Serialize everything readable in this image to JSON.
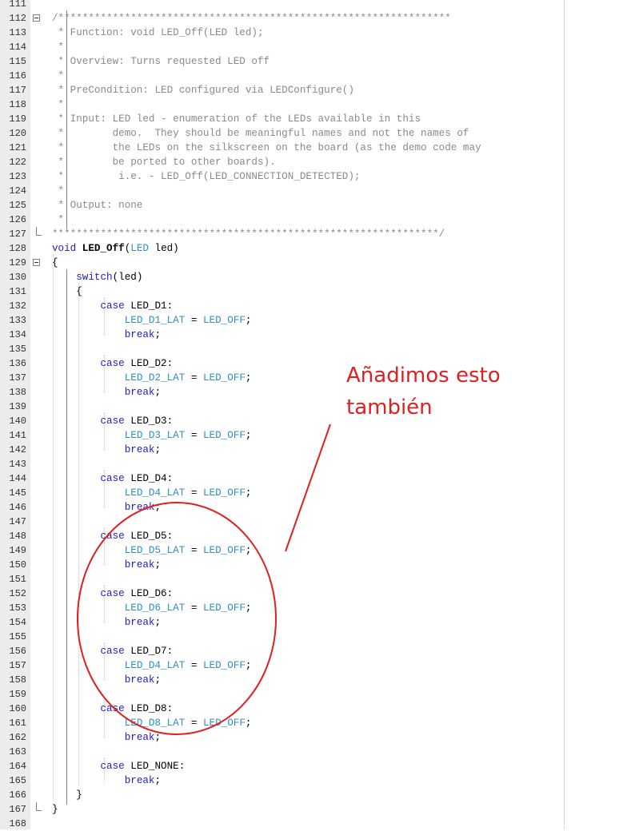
{
  "lines": [
    {
      "n": "111",
      "tokens": []
    },
    {
      "n": "112",
      "tokens": [
        {
          "t": "/*****************************************************************",
          "c": "comment"
        }
      ]
    },
    {
      "n": "113",
      "tokens": [
        {
          "t": " * Function: void LED_Off(LED led);",
          "c": "comment"
        }
      ]
    },
    {
      "n": "114",
      "tokens": [
        {
          "t": " *",
          "c": "comment"
        }
      ]
    },
    {
      "n": "115",
      "tokens": [
        {
          "t": " * Overview: Turns requested LED off",
          "c": "comment"
        }
      ]
    },
    {
      "n": "116",
      "tokens": [
        {
          "t": " *",
          "c": "comment"
        }
      ]
    },
    {
      "n": "117",
      "tokens": [
        {
          "t": " * PreCondition: LED configured via LEDConfigure()",
          "c": "comment"
        }
      ]
    },
    {
      "n": "118",
      "tokens": [
        {
          "t": " *",
          "c": "comment"
        }
      ]
    },
    {
      "n": "119",
      "tokens": [
        {
          "t": " * Input: LED led - enumeration of the LEDs available in this",
          "c": "comment"
        }
      ]
    },
    {
      "n": "120",
      "tokens": [
        {
          "t": " *        demo.  They should be meaningful names and not the names of",
          "c": "comment"
        }
      ]
    },
    {
      "n": "121",
      "tokens": [
        {
          "t": " *        the LEDs on the silkscreen on the board (as the demo code may",
          "c": "comment"
        }
      ]
    },
    {
      "n": "122",
      "tokens": [
        {
          "t": " *        be ported to other boards).",
          "c": "comment"
        }
      ]
    },
    {
      "n": "123",
      "tokens": [
        {
          "t": " *         i.e. - LED_Off(LED_CONNECTION_DETECTED);",
          "c": "comment"
        }
      ]
    },
    {
      "n": "124",
      "tokens": [
        {
          "t": " *",
          "c": "comment"
        }
      ]
    },
    {
      "n": "125",
      "tokens": [
        {
          "t": " * Output: none",
          "c": "comment"
        }
      ]
    },
    {
      "n": "126",
      "tokens": [
        {
          "t": " *",
          "c": "comment"
        }
      ]
    },
    {
      "n": "127",
      "tokens": [
        {
          "t": "****************************************************************/",
          "c": "comment"
        }
      ]
    },
    {
      "n": "128",
      "tokens": [
        {
          "t": "void ",
          "c": "kw"
        },
        {
          "t": "LED_Off",
          "c": "fn"
        },
        {
          "t": "(",
          "c": "plain"
        },
        {
          "t": "LED",
          "c": "ident"
        },
        {
          "t": " led)",
          "c": "plain"
        }
      ]
    },
    {
      "n": "129",
      "tokens": [
        {
          "t": "{",
          "c": "plain"
        }
      ]
    },
    {
      "n": "130",
      "tokens": [
        {
          "t": "    ",
          "c": "plain"
        },
        {
          "t": "switch",
          "c": "kw"
        },
        {
          "t": "(led)",
          "c": "plain"
        }
      ]
    },
    {
      "n": "131",
      "tokens": [
        {
          "t": "    {",
          "c": "plain"
        }
      ]
    },
    {
      "n": "132",
      "tokens": [
        {
          "t": "        ",
          "c": "plain"
        },
        {
          "t": "case",
          "c": "kw"
        },
        {
          "t": " LED_D1:",
          "c": "plain"
        }
      ]
    },
    {
      "n": "133",
      "tokens": [
        {
          "t": "            ",
          "c": "plain"
        },
        {
          "t": "LED_D1_LAT",
          "c": "ident"
        },
        {
          "t": " = ",
          "c": "plain"
        },
        {
          "t": "LED_OFF",
          "c": "ident"
        },
        {
          "t": ";",
          "c": "plain"
        }
      ]
    },
    {
      "n": "134",
      "tokens": [
        {
          "t": "            ",
          "c": "plain"
        },
        {
          "t": "break",
          "c": "kw"
        },
        {
          "t": ";",
          "c": "plain"
        }
      ]
    },
    {
      "n": "135",
      "tokens": []
    },
    {
      "n": "136",
      "tokens": [
        {
          "t": "        ",
          "c": "plain"
        },
        {
          "t": "case",
          "c": "kw"
        },
        {
          "t": " LED_D2:",
          "c": "plain"
        }
      ]
    },
    {
      "n": "137",
      "tokens": [
        {
          "t": "            ",
          "c": "plain"
        },
        {
          "t": "LED_D2_LAT",
          "c": "ident"
        },
        {
          "t": " = ",
          "c": "plain"
        },
        {
          "t": "LED_OFF",
          "c": "ident"
        },
        {
          "t": ";",
          "c": "plain"
        }
      ]
    },
    {
      "n": "138",
      "tokens": [
        {
          "t": "            ",
          "c": "plain"
        },
        {
          "t": "break",
          "c": "kw"
        },
        {
          "t": ";",
          "c": "plain"
        }
      ]
    },
    {
      "n": "139",
      "tokens": []
    },
    {
      "n": "140",
      "tokens": [
        {
          "t": "        ",
          "c": "plain"
        },
        {
          "t": "case",
          "c": "kw"
        },
        {
          "t": " LED_D3:",
          "c": "plain"
        }
      ]
    },
    {
      "n": "141",
      "tokens": [
        {
          "t": "            ",
          "c": "plain"
        },
        {
          "t": "LED_D3_LAT",
          "c": "ident"
        },
        {
          "t": " = ",
          "c": "plain"
        },
        {
          "t": "LED_OFF",
          "c": "ident"
        },
        {
          "t": ";",
          "c": "plain"
        }
      ]
    },
    {
      "n": "142",
      "tokens": [
        {
          "t": "            ",
          "c": "plain"
        },
        {
          "t": "break",
          "c": "kw"
        },
        {
          "t": ";",
          "c": "plain"
        }
      ]
    },
    {
      "n": "143",
      "tokens": []
    },
    {
      "n": "144",
      "tokens": [
        {
          "t": "        ",
          "c": "plain"
        },
        {
          "t": "case",
          "c": "kw"
        },
        {
          "t": " LED_D4:",
          "c": "plain"
        }
      ]
    },
    {
      "n": "145",
      "tokens": [
        {
          "t": "            ",
          "c": "plain"
        },
        {
          "t": "LED_D4_LAT",
          "c": "ident"
        },
        {
          "t": " = ",
          "c": "plain"
        },
        {
          "t": "LED_OFF",
          "c": "ident"
        },
        {
          "t": ";",
          "c": "plain"
        }
      ]
    },
    {
      "n": "146",
      "tokens": [
        {
          "t": "            ",
          "c": "plain"
        },
        {
          "t": "break",
          "c": "kw"
        },
        {
          "t": ";",
          "c": "plain"
        }
      ]
    },
    {
      "n": "147",
      "tokens": []
    },
    {
      "n": "148",
      "tokens": [
        {
          "t": "        ",
          "c": "plain"
        },
        {
          "t": "case",
          "c": "kw"
        },
        {
          "t": " LED_D5:",
          "c": "plain"
        }
      ]
    },
    {
      "n": "149",
      "tokens": [
        {
          "t": "            ",
          "c": "plain"
        },
        {
          "t": "LED_D5_LAT",
          "c": "ident"
        },
        {
          "t": " = ",
          "c": "plain"
        },
        {
          "t": "LED_OFF",
          "c": "ident"
        },
        {
          "t": ";",
          "c": "plain"
        }
      ]
    },
    {
      "n": "150",
      "tokens": [
        {
          "t": "            ",
          "c": "plain"
        },
        {
          "t": "break",
          "c": "kw"
        },
        {
          "t": ";",
          "c": "plain"
        }
      ]
    },
    {
      "n": "151",
      "tokens": []
    },
    {
      "n": "152",
      "tokens": [
        {
          "t": "        ",
          "c": "plain"
        },
        {
          "t": "case",
          "c": "kw"
        },
        {
          "t": " LED_D6:",
          "c": "plain"
        }
      ]
    },
    {
      "n": "153",
      "tokens": [
        {
          "t": "            ",
          "c": "plain"
        },
        {
          "t": "LED_D6_LAT",
          "c": "ident"
        },
        {
          "t": " = ",
          "c": "plain"
        },
        {
          "t": "LED_OFF",
          "c": "ident"
        },
        {
          "t": ";",
          "c": "plain"
        }
      ]
    },
    {
      "n": "154",
      "tokens": [
        {
          "t": "            ",
          "c": "plain"
        },
        {
          "t": "break",
          "c": "kw"
        },
        {
          "t": ";",
          "c": "plain"
        }
      ]
    },
    {
      "n": "155",
      "tokens": []
    },
    {
      "n": "156",
      "tokens": [
        {
          "t": "        ",
          "c": "plain"
        },
        {
          "t": "case",
          "c": "kw"
        },
        {
          "t": " LED_D7:",
          "c": "plain"
        }
      ]
    },
    {
      "n": "157",
      "tokens": [
        {
          "t": "            ",
          "c": "plain"
        },
        {
          "t": "LED_D4_LAT",
          "c": "ident"
        },
        {
          "t": " = ",
          "c": "plain"
        },
        {
          "t": "LED_OFF",
          "c": "ident"
        },
        {
          "t": ";",
          "c": "plain"
        }
      ]
    },
    {
      "n": "158",
      "tokens": [
        {
          "t": "            ",
          "c": "plain"
        },
        {
          "t": "break",
          "c": "kw"
        },
        {
          "t": ";",
          "c": "plain"
        }
      ]
    },
    {
      "n": "159",
      "tokens": []
    },
    {
      "n": "160",
      "tokens": [
        {
          "t": "        ",
          "c": "plain"
        },
        {
          "t": "case",
          "c": "kw"
        },
        {
          "t": " LED_D8:",
          "c": "plain"
        }
      ]
    },
    {
      "n": "161",
      "tokens": [
        {
          "t": "            ",
          "c": "plain"
        },
        {
          "t": "LED_D8_LAT",
          "c": "ident"
        },
        {
          "t": " = ",
          "c": "plain"
        },
        {
          "t": "LED_OFF",
          "c": "ident"
        },
        {
          "t": ";",
          "c": "plain"
        }
      ]
    },
    {
      "n": "162",
      "tokens": [
        {
          "t": "            ",
          "c": "plain"
        },
        {
          "t": "break",
          "c": "kw"
        },
        {
          "t": ";",
          "c": "plain"
        }
      ]
    },
    {
      "n": "163",
      "tokens": []
    },
    {
      "n": "164",
      "tokens": [
        {
          "t": "        ",
          "c": "plain"
        },
        {
          "t": "case",
          "c": "kw"
        },
        {
          "t": " LED_NONE:",
          "c": "plain"
        }
      ]
    },
    {
      "n": "165",
      "tokens": [
        {
          "t": "            ",
          "c": "plain"
        },
        {
          "t": "break",
          "c": "kw"
        },
        {
          "t": ";",
          "c": "plain"
        }
      ]
    },
    {
      "n": "166",
      "tokens": [
        {
          "t": "    }",
          "c": "plain"
        }
      ]
    },
    {
      "n": "167",
      "tokens": [
        {
          "t": "}",
          "c": "plain"
        }
      ]
    },
    {
      "n": "168",
      "tokens": []
    }
  ],
  "annotation": {
    "line1": "Añadimos esto",
    "line2": "también",
    "color": "#e02020"
  },
  "colors": {
    "comment": "#8a8a8a",
    "keyword": "#1c1cc8",
    "identifier": "#2d8fc4",
    "gutter": "#ececec"
  }
}
